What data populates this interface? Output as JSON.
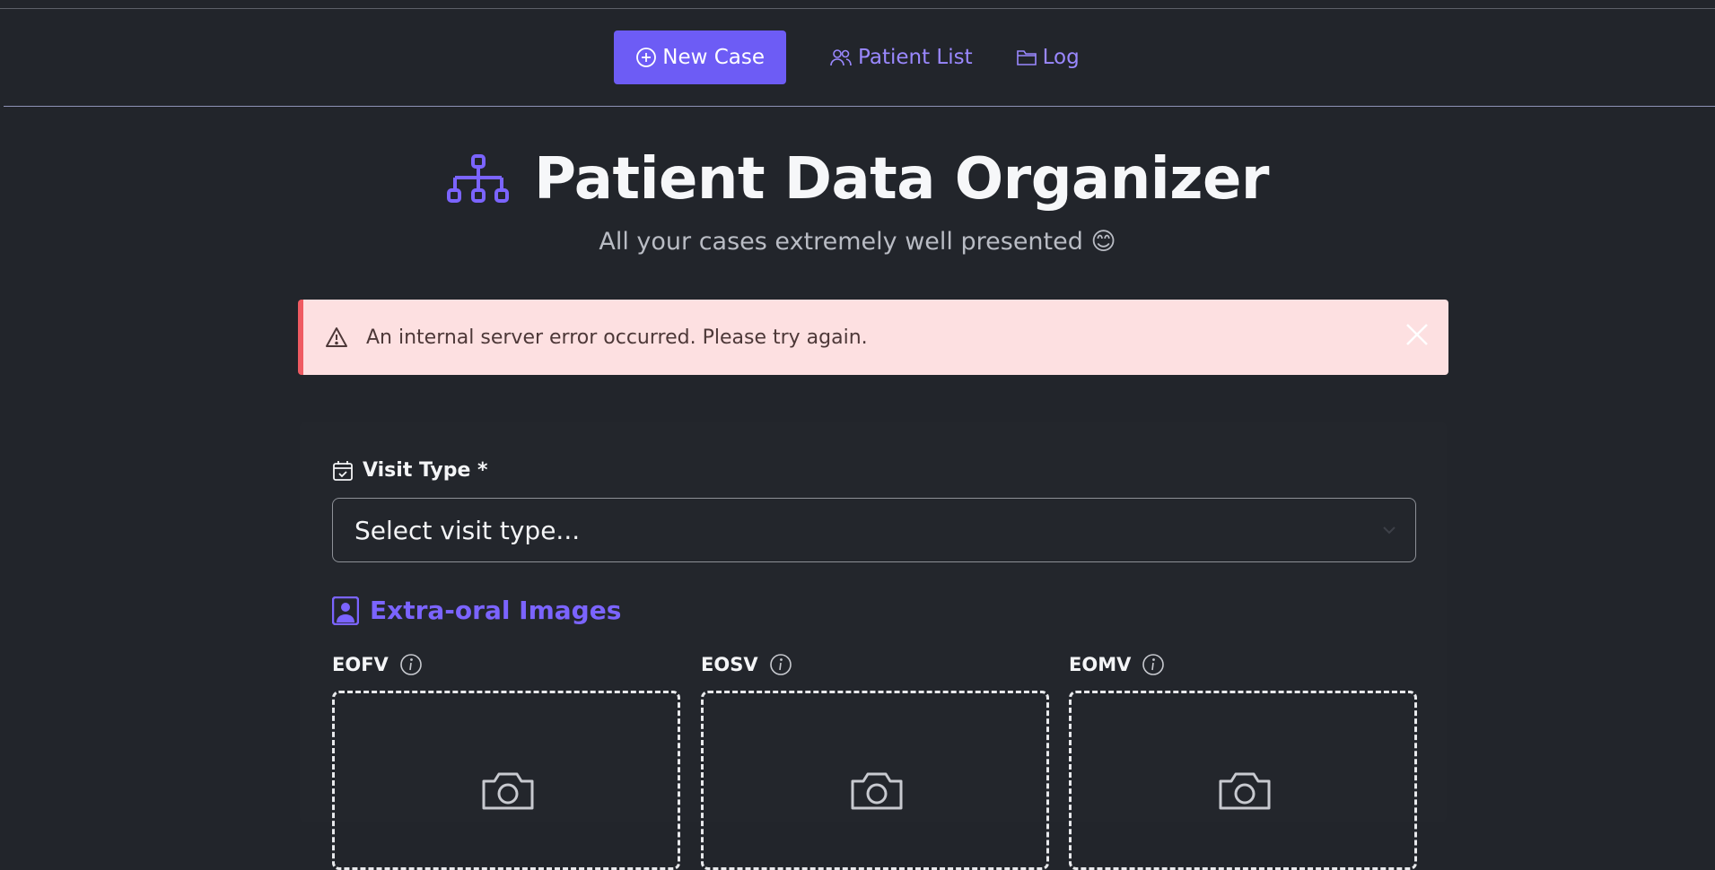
{
  "nav": {
    "items": [
      {
        "label": "New Case",
        "icon": "plus-circle-icon",
        "active": true
      },
      {
        "label": "Patient List",
        "icon": "users-icon",
        "active": false
      },
      {
        "label": "Log",
        "icon": "folder-icon",
        "active": false
      }
    ]
  },
  "header": {
    "title": "Patient Data Organizer",
    "subtitle": "All your cases extremely well presented 😊",
    "icon": "hierarchy-icon"
  },
  "alert": {
    "message": "An internal server error occurred. Please try again.",
    "icon": "warning-triangle-icon",
    "close_icon": "close-icon"
  },
  "form": {
    "visit_type": {
      "label": "Visit Type *",
      "icon": "calendar-check-icon",
      "placeholder": "Select visit type..."
    },
    "extra_oral": {
      "title": "Extra-oral Images",
      "icon": "portrait-icon",
      "images": [
        {
          "label": "EOFV"
        },
        {
          "label": "EOSV"
        },
        {
          "label": "EOMV"
        }
      ]
    }
  },
  "colors": {
    "background": "#22252b",
    "accent": "#6d5cf5",
    "accent_text": "#9a88ff",
    "alert_bg": "#fde0e1",
    "alert_border": "#ef5b62"
  }
}
